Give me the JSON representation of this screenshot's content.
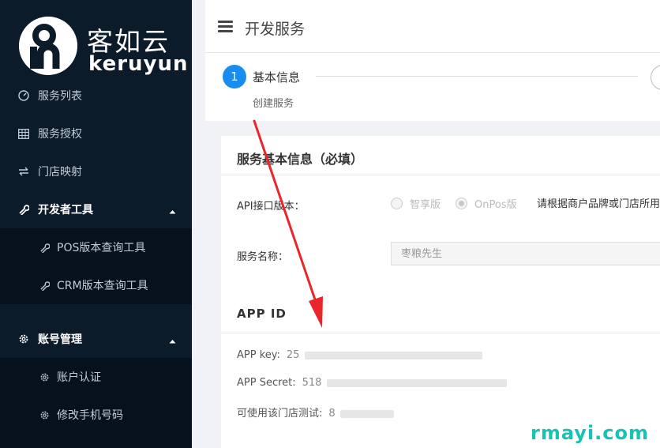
{
  "brand": {
    "cn": "客如云",
    "en": "keruyun"
  },
  "sidebar": {
    "items": [
      {
        "label": "服务列表",
        "icon": "gauge-icon"
      },
      {
        "label": "服务授权",
        "icon": "grid-icon"
      },
      {
        "label": "门店映射",
        "icon": "swap-icon"
      },
      {
        "label": "开发者工具",
        "icon": "wrench-icon"
      },
      {
        "label": "账号管理",
        "icon": "gear-icon"
      }
    ],
    "dev_tools": [
      "POS版本查询工具",
      "CRM版本查询工具"
    ],
    "account": [
      "账户认证",
      "修改手机号码"
    ]
  },
  "header": {
    "title": "开发服务"
  },
  "steps": {
    "number": "1",
    "title": "基本信息",
    "subtitle": "创建服务"
  },
  "form": {
    "section_title": "服务基本信息（必填）",
    "api_label": "API接口版本：",
    "api_options": [
      "智享版",
      "OnPos版"
    ],
    "api_hint": "请根据商户品牌或门店所用",
    "name_label": "服务名称：",
    "name_placeholder": "枣粮先生"
  },
  "app": {
    "title": "APP  ID",
    "key_label": "APP key:",
    "key_value": "25",
    "secret_label": "APP Secret:",
    "secret_value": "518",
    "test_label": "可使用该门店测试:",
    "test_value": "8"
  },
  "watermark": "rmayi.com",
  "colors": {
    "sidebar": "#0c1b2a",
    "accent": "#1a8cf0",
    "arrow": "#e8262b"
  }
}
